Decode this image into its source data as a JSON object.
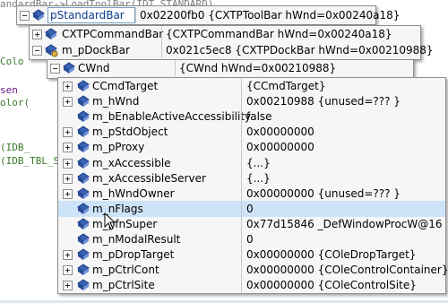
{
  "code_lines": [
    "andardBar->LoadToolBar(IDT_STANDARD)",
    "Colo",
    "sen",
    "olor(",
    "(IDB_",
    "(IDB_TBL_S"
  ],
  "datatip_root": {
    "name": "pStandardBar",
    "value": "0x02200fb0 {CXTPToolBar hWnd=0x00240a18}"
  },
  "level1": [
    {
      "name": "CXTPCommandBar",
      "value": "{CXTPCommandBar hWnd=0x00240a18}"
    },
    {
      "name": "m_pDockBar",
      "value": "0x021c5ec8 {CXTPDockBar hWnd=0x00210988}"
    }
  ],
  "level2": {
    "name": "CWnd",
    "value": "{CWnd hWnd=0x00210988}"
  },
  "members": [
    {
      "name": "CCmdTarget",
      "value": "{CCmdTarget}"
    },
    {
      "name": "m_hWnd",
      "value": "0x00210988 {unused=??? }"
    },
    {
      "name": "m_bEnableActiveAccessibility",
      "value": "false"
    },
    {
      "name": "m_pStdObject",
      "value": "0x00000000"
    },
    {
      "name": "m_pProxy",
      "value": "0x00000000"
    },
    {
      "name": "m_xAccessible",
      "value": "{...}"
    },
    {
      "name": "m_xAccessibleServer",
      "value": "{...}"
    },
    {
      "name": "m_hWndOwner",
      "value": "0x00000000 {unused=??? }"
    },
    {
      "name": "m_nFlags",
      "value": "0"
    },
    {
      "name": "m_pfnSuper",
      "value": "0x77d15846 _DefWindowProcW@16"
    },
    {
      "name": "m_nModalResult",
      "value": "0"
    },
    {
      "name": "m_pDropTarget",
      "value": "0x00000000 {COleDropTarget}"
    },
    {
      "name": "m_pCtrlCont",
      "value": "0x00000000 {COleControlContainer}"
    },
    {
      "name": "m_pCtrlSite",
      "value": "0x00000000 {COleControlSite}"
    }
  ],
  "colors": {
    "selection": "#cde3f8",
    "accent_blue": "#0a3a8a"
  }
}
